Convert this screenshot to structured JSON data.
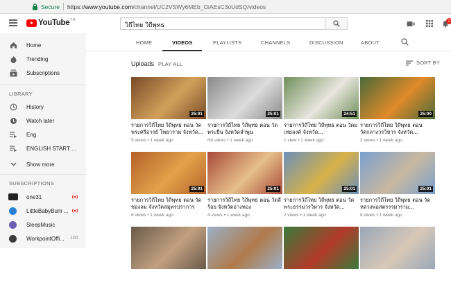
{
  "browser": {
    "secure_label": "Secure",
    "url_scheme": "https://",
    "url_host": "www.youtube.com",
    "url_path": "/channel/UC2VSWy6MEb_OiAEsC3oUdSQ/videos"
  },
  "masthead": {
    "logo_text": "YouTube",
    "logo_region": "TH",
    "search_value": "วิถีไทย วิถีพุทธ",
    "notification_count": "2",
    "brand_color": "#ff0000"
  },
  "sidebar": {
    "main": [
      {
        "label": "Home",
        "icon": "home-icon"
      },
      {
        "label": "Trending",
        "icon": "flame-icon"
      },
      {
        "label": "Subscriptions",
        "icon": "subscriptions-icon"
      }
    ],
    "library_heading": "LIBRARY",
    "library": [
      {
        "label": "History",
        "icon": "history-icon"
      },
      {
        "label": "Watch later",
        "icon": "clock-icon"
      },
      {
        "label": "Eng",
        "icon": "playlist-icon"
      },
      {
        "label": "ENGLISH START ...",
        "icon": "playlist-icon"
      },
      {
        "label": "Show more",
        "icon": "chevron-down-icon"
      }
    ],
    "subscriptions_heading": "SUBSCRIPTIONS",
    "subscriptions": [
      {
        "label": "one31",
        "badge": "live",
        "color": "#222222"
      },
      {
        "label": "LittleBabyBum ...",
        "badge": "live",
        "color": "#2a7fd4"
      },
      {
        "label": "SleepMusic",
        "badge": "",
        "color": "#6b5fb3"
      },
      {
        "label": "WorkpointOffi...",
        "badge": "100",
        "color": "#3b3b3b"
      }
    ]
  },
  "tabs": [
    "HOME",
    "VIDEOS",
    "PLAYLISTS",
    "CHANNELS",
    "DISCUSSION",
    "ABOUT"
  ],
  "active_tab": "VIDEOS",
  "uploads": {
    "title": "Uploads",
    "play_all": "PLAY ALL",
    "sort_by": "SORT BY"
  },
  "videos": [
    {
      "title": "รายการวิถีไทย วิถีพุทธ ตอน วัดพระศรีอารย์ โพธาราม จังหวัด...",
      "meta": "5 views • 1 week ago",
      "duration": "25:01",
      "c1": "#7a4a2a",
      "c2": "#d1a15a"
    },
    {
      "title": "รายการวิถีไทย วิถีพุทธ ตอน วัดพระยืน จังหวัดลำพูน",
      "meta": "No views • 1 week ago",
      "duration": "25:01",
      "c1": "#8a8a8a",
      "c2": "#dcdcdc"
    },
    {
      "title": "รายการวิถีไทย วิถีพุทธ ตอน วัดมเทยลงค์ จังหวัด...",
      "meta": "1 view • 1 week ago",
      "duration": "24:51",
      "c1": "#6f8f5a",
      "c2": "#e9e6df"
    },
    {
      "title": "รายการวิถีไทย วิถีพุทธ ตอน วัดกลางวรวิหาร จังหวัด...",
      "meta": "2 views • 1 week ago",
      "duration": "25:00",
      "c1": "#4a6a3a",
      "c2": "#e08a2a"
    },
    {
      "title": "รายการวิถีไทย วิถีพุทธ ตอน วัดช่องลม จังหวัดสมุทรปราการ",
      "meta": "6 views • 1 week ago",
      "duration": "25:01",
      "c1": "#b5612a",
      "c2": "#e2a24a"
    },
    {
      "title": "รายการวิถีไทย วิถีพุทธ ตอน วัดลี่ร้อย จังหวัดอ่างทอง",
      "meta": "4 views • 1 week ago",
      "duration": "25:01",
      "c1": "#a84a3a",
      "c2": "#e7c08a"
    },
    {
      "title": "รายการวิถีไทย วิถีพุทธ ตอน วัดพระธรรมวรวิหาร จังหวัด...",
      "meta": "2 views • 1 week ago",
      "duration": "25:01",
      "c1": "#6b8fb8",
      "c2": "#d8b24a"
    },
    {
      "title": "รายการวิถีไทย วิถีพุทธ ตอน วัดหลวงพ่อสตรรรมาราม...",
      "meta": "8 views • 1 week ago",
      "duration": "25:01",
      "c1": "#7aa0cf",
      "c2": "#c8b8a0"
    },
    {
      "title": "",
      "meta": "",
      "duration": "",
      "c1": "#6a5a4a",
      "c2": "#c2a080"
    },
    {
      "title": "",
      "meta": "",
      "duration": "",
      "c1": "#9ab0c8",
      "c2": "#b07a4a"
    },
    {
      "title": "",
      "meta": "",
      "duration": "",
      "c1": "#3a7a3a",
      "c2": "#b23a2a"
    },
    {
      "title": "",
      "meta": "",
      "duration": "",
      "c1": "#9aa8b8",
      "c2": "#d8c8b8"
    }
  ]
}
